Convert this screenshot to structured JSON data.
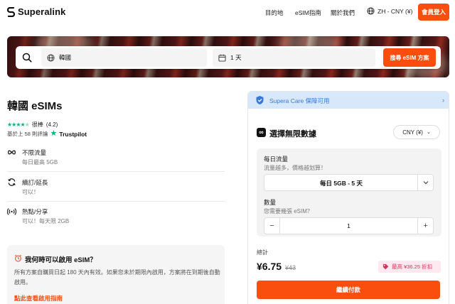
{
  "header": {
    "logo": "Superalink",
    "nav": [
      "目的地",
      "eSIM指南",
      "關於我們"
    ],
    "locale": "ZH - CNY (¥)",
    "login": "會員登入"
  },
  "search": {
    "destination": "韓國",
    "duration": "1 天",
    "button": "搜尋 eSIM 方案"
  },
  "product": {
    "title": "韓國 eSIMs",
    "rating_text": "很棒",
    "rating_score": "(4.2)",
    "reviews": "基於上 58 則評論",
    "review_platform": "Trustpilot"
  },
  "features": [
    {
      "title": "不限流量",
      "subtitle": "每日最高 5GB"
    },
    {
      "title": "續訂/延長",
      "subtitle": "可以！"
    },
    {
      "title": "熱點/分享",
      "subtitle": "可以！每天限 2GB"
    }
  ],
  "faq": {
    "title": "我何時可以啟用 eSIM？",
    "body": "所有方案自購買日起 180 天內有效。如果您未於期限內啟用，方案將在到期後自動啟用。",
    "link": "點此查看啟用指南"
  },
  "panel": {
    "care": "Supera Care 保障可用",
    "plan_title": "選擇無限數據",
    "currency": "CNY (¥)",
    "daily_label": "每日流量",
    "daily_hint": "流量越多，價格越划算！",
    "daily_value": "每日 5GB - 5 天",
    "qty_label": "數量",
    "qty_hint": "您需要幾張 eSIM？",
    "qty_value": "1",
    "total_label": "總計",
    "price": "¥6.75",
    "old_price": "¥43",
    "discount": "最高 ¥36.25 折扣",
    "continue": "繼續付款"
  },
  "colors": {
    "accent": "#fa4e0f",
    "care_bg": "#d8e8fb",
    "care_text": "#3a78d8",
    "trustpilot": "#00b67a",
    "discount_text": "#d6335a"
  }
}
